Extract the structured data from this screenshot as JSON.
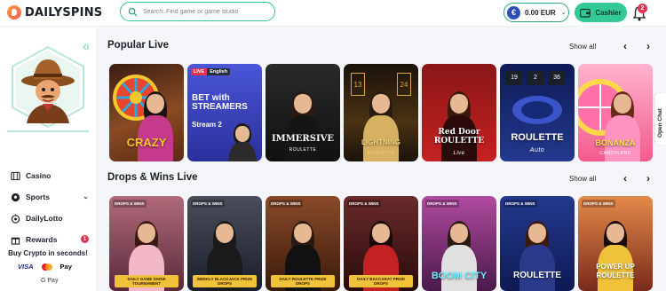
{
  "brand": {
    "name": "DAILYSPINS"
  },
  "search": {
    "placeholder": "Search: Find game or game studio"
  },
  "wallet": {
    "currency_symbol": "€",
    "balance": "0.00 EUR"
  },
  "cashier": {
    "label": "Cashier"
  },
  "notifications": {
    "count": "2"
  },
  "sidebar": {
    "items": [
      {
        "label": "Casino",
        "icon": "casino-icon"
      },
      {
        "label": "Sports",
        "icon": "soccer-ball-icon"
      },
      {
        "label": "DailyLotto",
        "icon": "lotto-icon"
      },
      {
        "label": "Rewards",
        "icon": "gift-icon",
        "badge": "1"
      }
    ],
    "crypto_text": "Buy Crypto in seconds!",
    "payments": [
      "VISA",
      "Pay",
      "G Pay"
    ]
  },
  "sections": [
    {
      "title": "Popular Live",
      "show_all": "Show all",
      "tiles": [
        {
          "title": "CRAZY",
          "subtitle": "",
          "bg": "#6b3a2a"
        },
        {
          "title": "BET with STREAMERS",
          "subtitle": "Stream 2",
          "bg": "#3c3ea8",
          "live": "LIVE",
          "lang": "English"
        },
        {
          "title": "IMMERSIVE",
          "subtitle": "ROULETTE",
          "bg": "#1a1a1a"
        },
        {
          "title": "LIGHTNING",
          "subtitle": "ROULETTE",
          "bg": "#3a2a14"
        },
        {
          "title": "Red Door ROULETTE",
          "subtitle": "Live",
          "bg": "#a31c1c"
        },
        {
          "title": "ROULETTE",
          "subtitle": "Auto",
          "bg": "#1c2b6e"
        },
        {
          "title": "BONANZA",
          "subtitle": "CANDYLAND",
          "bg": "#e84f86"
        }
      ]
    },
    {
      "title": "Drops & Wins Live",
      "show_all": "Show all",
      "tiles": [
        {
          "caption": "DAILY GAME SHOW TOURNAMENT",
          "bg": "#7a3f4a"
        },
        {
          "caption": "WEEKLY BLACKJACK PRIZE DROPS",
          "bg": "#2a2e3a"
        },
        {
          "caption": "DAILY ROULETTE PRIZE DROPS",
          "bg": "#5b2a1a"
        },
        {
          "caption": "DAILY BACCARAT PRIZE DROPS",
          "bg": "#4a1a1e"
        },
        {
          "caption": "BOOM CITY",
          "bg": "#7a2a6a"
        },
        {
          "caption": "ROULETTE",
          "bg": "#1a2a6a"
        },
        {
          "caption": "POWER UP ROULETTE",
          "bg": "#b8562a"
        }
      ]
    }
  ],
  "drops_badge": "DROPS & WINS",
  "open_chat": "Open Chat"
}
